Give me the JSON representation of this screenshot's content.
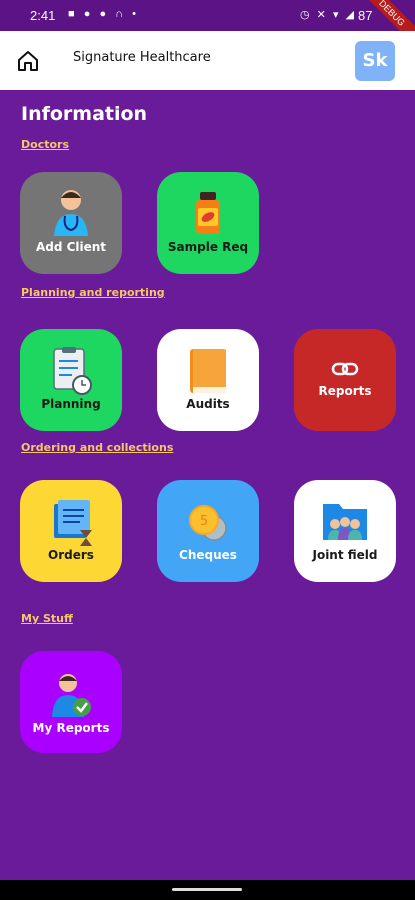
{
  "status_bar": {
    "time": "2:41",
    "battery": "87",
    "left_icons": [
      "gmail-icon",
      "facebook-icon",
      "facebook-icon",
      "headset-icon",
      "dot-icon"
    ],
    "right_icons": [
      "alarm-icon",
      "mute-icon",
      "wifi-icon",
      "signal-icon",
      "battery-icon"
    ],
    "debug_banner": "DEBUG"
  },
  "app_bar": {
    "title": "Signature Healthcare",
    "avatar_initials": "Sk",
    "home_icon": "home-icon"
  },
  "page": {
    "title": "Information"
  },
  "sections": {
    "doctors": "Doctors",
    "planning": "Planning and reporting",
    "ordering": "Ordering and collections",
    "my_stuff": "My Stuff"
  },
  "tiles": {
    "add_client": {
      "label": "Add Client",
      "icon": "doctor-icon",
      "color": "#757575"
    },
    "sample_req": {
      "label": "Sample Req",
      "icon": "medicine-bottle-icon",
      "color": "#1ed760"
    },
    "planning": {
      "label": "Planning",
      "icon": "clipboard-clock-icon",
      "color": "#1ed760"
    },
    "audits": {
      "label": "Audits",
      "icon": "book-icon",
      "color": "#ffffff"
    },
    "reports": {
      "label": "Reports",
      "icon": "link-icon",
      "color": "#c62828"
    },
    "orders": {
      "label": "Orders",
      "icon": "document-hourglass-icon",
      "color": "#fdd835"
    },
    "cheques": {
      "label": "Cheques",
      "icon": "coins-icon",
      "color": "#42a5f5"
    },
    "joint_field": {
      "label": "Joint field",
      "icon": "team-folder-icon",
      "color": "#ffffff"
    },
    "my_reports": {
      "label": "My Reports",
      "icon": "user-check-icon",
      "color": "#aa00ff"
    }
  },
  "colors": {
    "background": "#6a1b9a",
    "section_label": "#f6c667"
  }
}
